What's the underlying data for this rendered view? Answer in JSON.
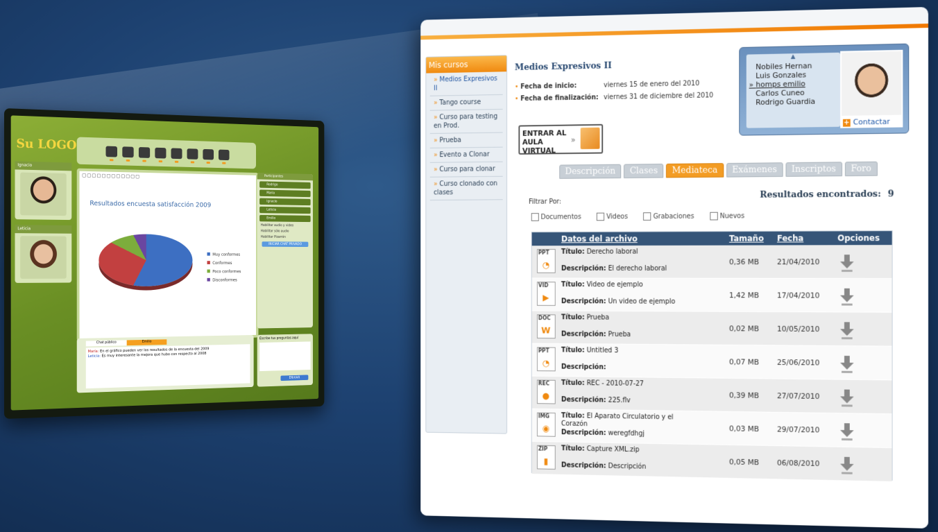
{
  "classroom": {
    "logo": "Su LOGO",
    "cams": [
      {
        "name": "Ignacio"
      },
      {
        "name": "Leticia"
      }
    ],
    "board_title": "Resultados encuesta satisfacción 2009",
    "legend": [
      {
        "label": "Muy conformes",
        "color": "#3d6fc2"
      },
      {
        "label": "Conformes",
        "color": "#c24040"
      },
      {
        "label": "Poco conformes",
        "color": "#7cad3c"
      },
      {
        "label": "Disconformes",
        "color": "#6a46a0"
      }
    ],
    "participants_title": "Participantes",
    "participants": [
      "Rodrigo",
      "Maria",
      "Ignacio",
      "Leticia",
      "Emilio"
    ],
    "options": [
      "Habilitar audio y video",
      "Habilitar sólo audio",
      "Habilitar Pizarrón"
    ],
    "private_chat_button": "INICIAR CHAT PRIVADO",
    "chat_tabs": [
      "Chat público",
      "Emilio"
    ],
    "chat_messages": [
      {
        "author": "María:",
        "text": "En el gráfico pueden ver los resultados de la encuesta del 2009"
      },
      {
        "author": "Leticia:",
        "text": "Es muy interesante la mejora que hubo con respecto al 2008"
      }
    ],
    "ask_label": "Escribe tus preguntas aquí",
    "send_button": "ENVIAR"
  },
  "sidebar": {
    "title": "Mis cursos",
    "items": [
      "Medios Expresivos II",
      "Tango course",
      "Curso para testing en Prod.",
      "Prueba",
      "Evento a Clonar",
      "Curso para clonar",
      "Curso clonado con clases"
    ]
  },
  "course": {
    "title": "Medios Expresivos II",
    "start_label": "Fecha de inicio:",
    "start_value": "viernes 15 de enero del 2010",
    "end_label": "Fecha de finalización:",
    "end_value": "viernes 31 de diciembre del 2010",
    "enter_button": "ENTRAR AL AULA VIRTUAL"
  },
  "people": {
    "list": [
      "Nobiles Hernan",
      "Luis Gonzales",
      "homps emilio",
      "Carlos Cuneo",
      "Rodrigo Guardia"
    ],
    "selected": "homps emilio",
    "contact_button": "Contactar"
  },
  "tabs": [
    "Descripción",
    "Clases",
    "Mediateca",
    "Exámenes",
    "Inscriptos",
    "Foro"
  ],
  "active_tab": "Mediateca",
  "results": {
    "label": "Resultados encontrados:",
    "count": "9"
  },
  "filter": {
    "label": "Filtrar Por:",
    "options": [
      "Documentos",
      "Videos",
      "Grabaciones",
      "Nuevos"
    ]
  },
  "table": {
    "headers": {
      "file": "Datos del archivo",
      "size": "Tamaño",
      "date": "Fecha",
      "options": "Opciones"
    },
    "title_label": "Título:",
    "desc_label": "Descripción:",
    "rows": [
      {
        "type": "PPT",
        "title": "Derecho laboral",
        "desc": "El derecho laboral",
        "size": "0,36 MB",
        "date": "21/04/2010"
      },
      {
        "type": "VID",
        "title": "Video de ejemplo",
        "desc": "Un video de ejemplo",
        "size": "1,42 MB",
        "date": "17/04/2010"
      },
      {
        "type": "DOC",
        "title": "Prueba",
        "desc": "Prueba",
        "size": "0,02 MB",
        "date": "10/05/2010"
      },
      {
        "type": "PPT",
        "title": "Untitled 3",
        "desc": "",
        "size": "0,07 MB",
        "date": "25/06/2010"
      },
      {
        "type": "REC",
        "title": "REC - 2010-07-27",
        "desc": "225.flv",
        "size": "0,39 MB",
        "date": "27/07/2010"
      },
      {
        "type": "IMG",
        "title": "El Aparato Circulatorio y el Corazón",
        "desc": "weregfdhgj",
        "size": "0,03 MB",
        "date": "29/07/2010"
      },
      {
        "type": "ZIP",
        "title": "Capture XML.zip",
        "desc": "Descripción",
        "size": "0,05 MB",
        "date": "06/08/2010"
      }
    ]
  }
}
